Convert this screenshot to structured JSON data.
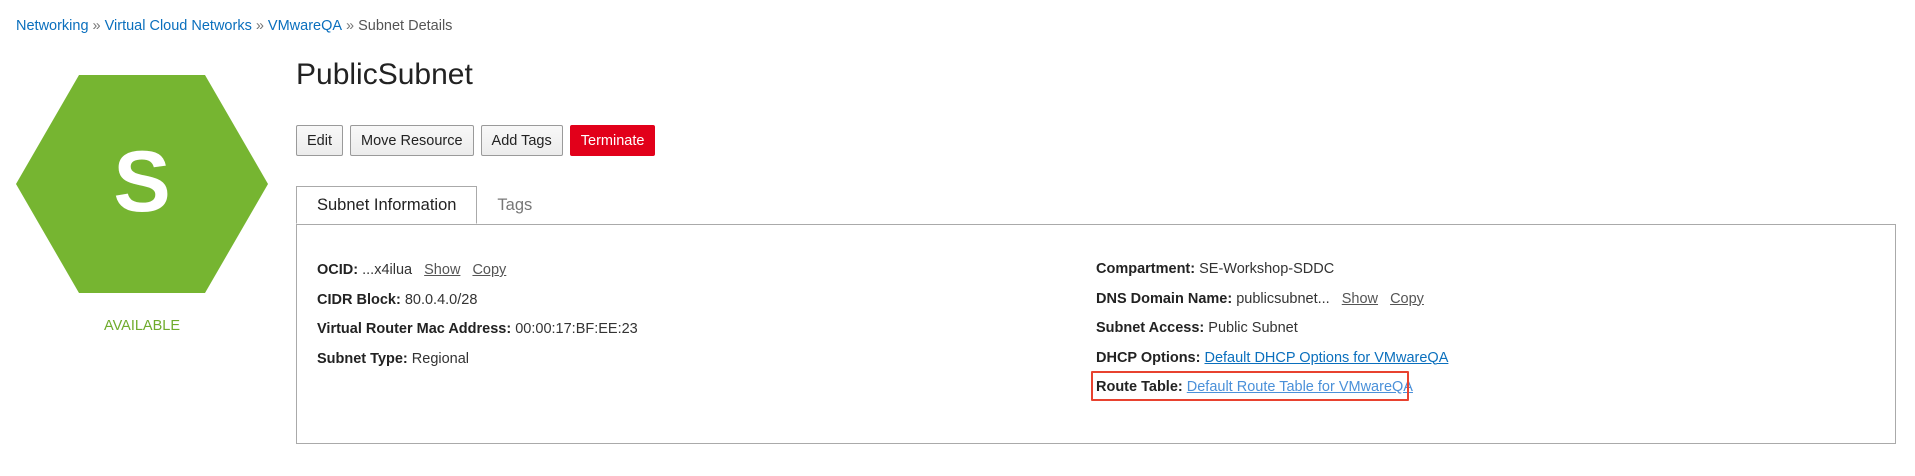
{
  "breadcrumb": {
    "items": [
      "Networking",
      "Virtual Cloud Networks",
      "VMwareQA"
    ],
    "separator": "»",
    "current": "Subnet Details"
  },
  "resource": {
    "icon_letter": "S",
    "icon_color": "#76b531",
    "state": "AVAILABLE",
    "title": "PublicSubnet"
  },
  "actions": {
    "edit": "Edit",
    "move": "Move Resource",
    "add_tags": "Add Tags",
    "terminate": "Terminate"
  },
  "tabs": [
    "Subnet Information",
    "Tags"
  ],
  "info_left": {
    "ocid_label": "OCID:",
    "ocid_value": "...x4ilua",
    "show": "Show",
    "copy": "Copy",
    "cidr_label": "CIDR Block:",
    "cidr_value": "80.0.4.0/28",
    "mac_label": "Virtual Router Mac Address:",
    "mac_value": "00:00:17:BF:EE:23",
    "type_label": "Subnet Type:",
    "type_value": "Regional"
  },
  "info_right": {
    "compartment_label": "Compartment:",
    "compartment_value": "SE-Workshop-SDDC",
    "dns_label": "DNS Domain Name:",
    "dns_value": "publicsubnet...",
    "show": "Show",
    "copy": "Copy",
    "access_label": "Subnet Access:",
    "access_value": "Public Subnet",
    "dhcp_label": "DHCP Options:",
    "dhcp_value": "Default DHCP Options for VMwareQA",
    "route_label": "Route Table:",
    "route_value": "Default Route Table for VMwareQA"
  },
  "colors": {
    "link": "#0a6fbd",
    "danger": "#e2001a",
    "available": "#6fab2b",
    "highlight": "#e8422f"
  }
}
